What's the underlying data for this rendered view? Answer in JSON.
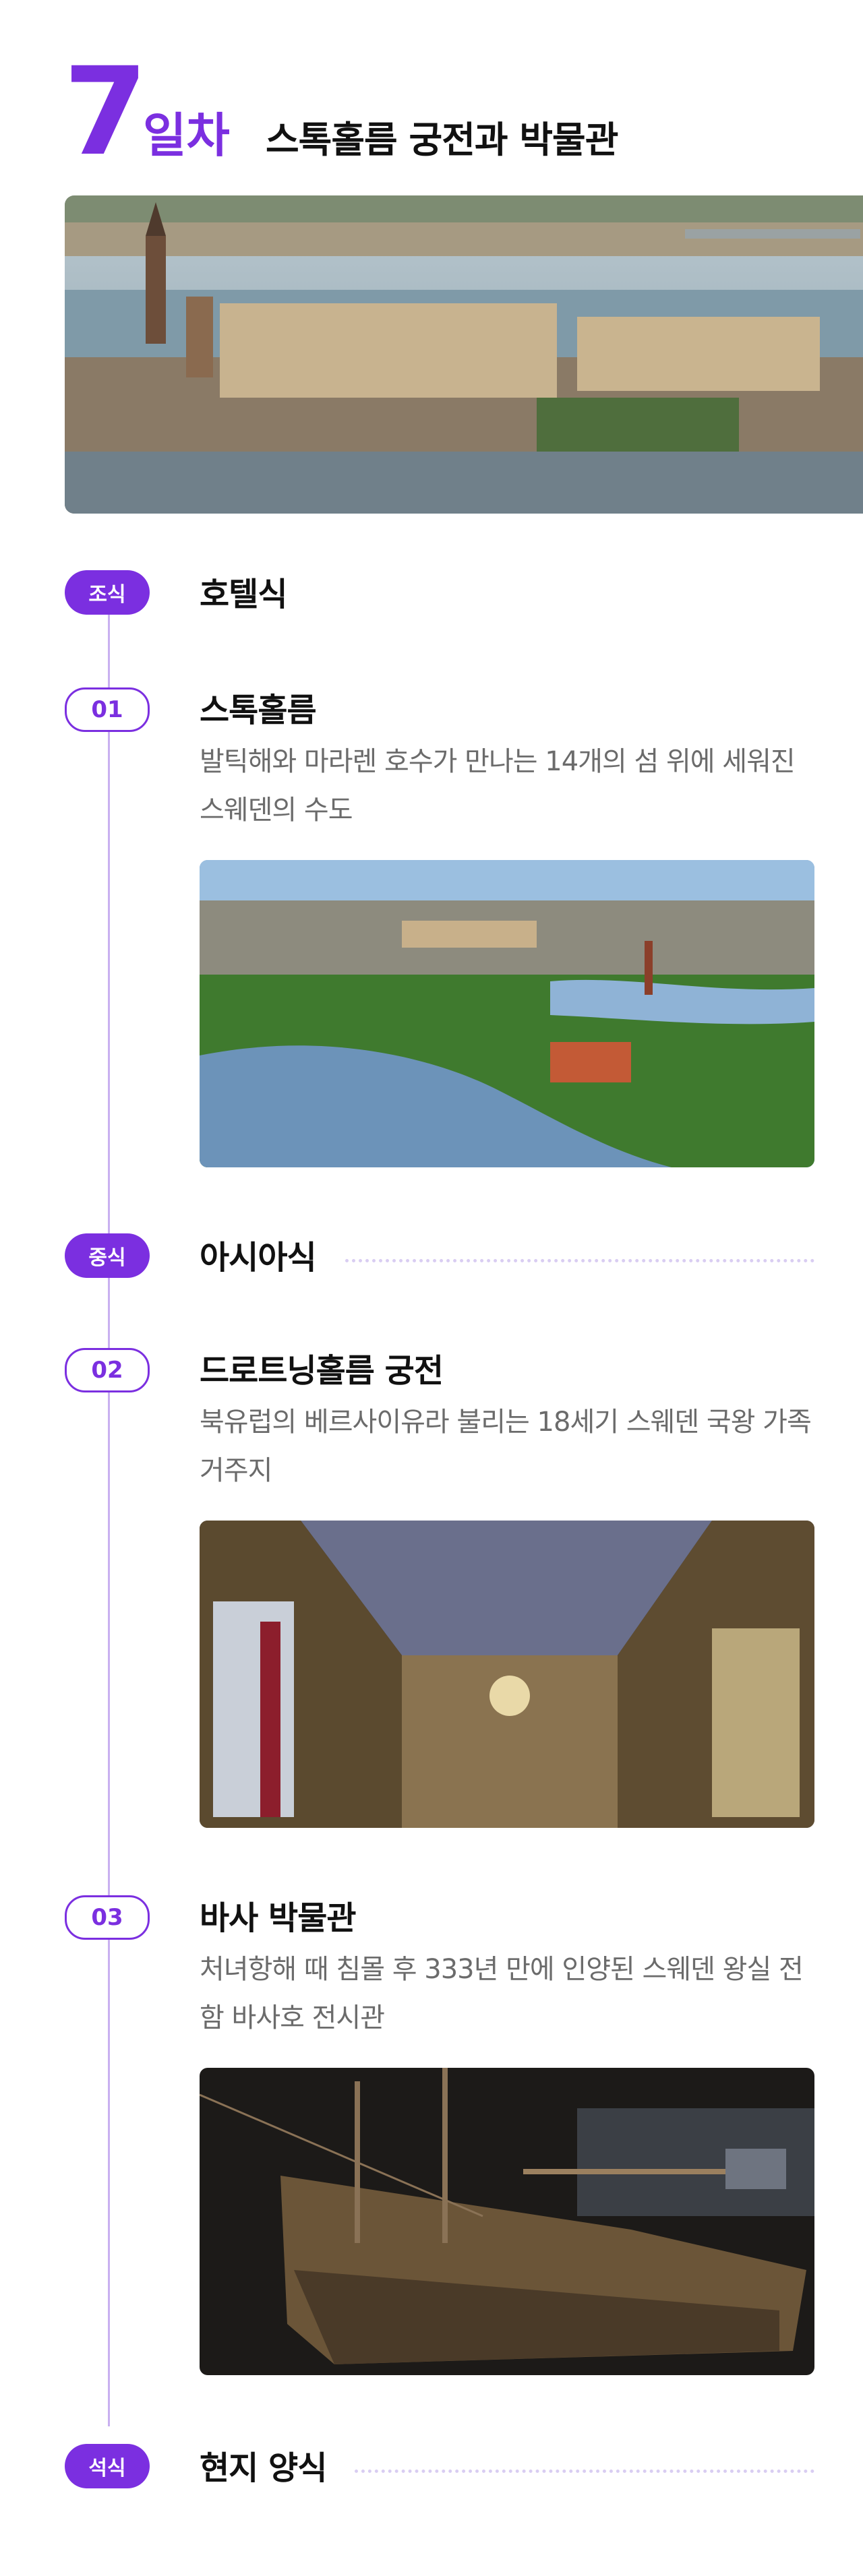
{
  "header": {
    "day_number": "7",
    "day_word": "일차",
    "title": "스톡홀름 궁전과 박물관"
  },
  "hero_image": {
    "alt": "Stockholm Royal Palace cityscape"
  },
  "colors": {
    "accent": "#7b2fe0",
    "timeline_line": "#c9b0f0",
    "description_text": "#6b6b6b"
  },
  "meals": {
    "breakfast": {
      "label": "조식",
      "value": "호텔식"
    },
    "lunch": {
      "label": "중식",
      "value": "아시아식"
    },
    "dinner": {
      "label": "석식",
      "value": "현지 양식"
    }
  },
  "spots": [
    {
      "number": "01",
      "title": "스톡홀름",
      "description": "발틱해와 마라렌 호수가 만나는 14개의 섬 위에 세워진 스웨덴의 수도",
      "image_alt": "Stockholm aerial view"
    },
    {
      "number": "02",
      "title": "드로트닝홀름 궁전",
      "description": "북유럽의 베르사이유라 불리는 18세기 스웨덴 국왕 가족 거주지",
      "image_alt": "Drottningholm palace gallery"
    },
    {
      "number": "03",
      "title": "바사 박물관",
      "description": "처녀항해 때 침몰 후 333년 만에 인양된 스웨덴 왕실 전함 바사호 전시관",
      "image_alt": "Vasa ship museum"
    }
  ]
}
